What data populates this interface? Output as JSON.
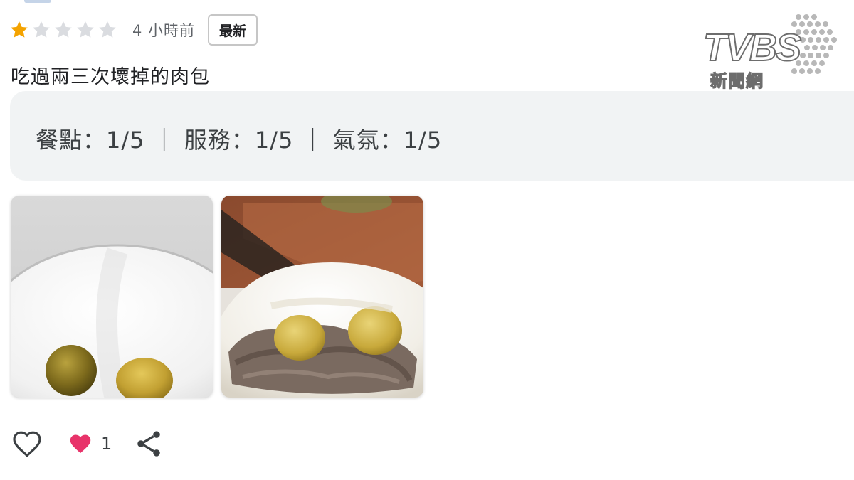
{
  "review": {
    "rating": 1,
    "rating_max": 5,
    "time_ago": "4 小時前",
    "badge": "最新",
    "text": "吃過兩三次壞掉的肉包",
    "subratings_text": "餐點：1/5 ｜ 服務：1/5 ｜ 氣氛：1/5"
  },
  "photos": [
    {
      "name": "photo-plate-with-chestnuts"
    },
    {
      "name": "photo-bun-with-filling"
    }
  ],
  "actions": {
    "like_icon": "heart-outline-icon",
    "reaction_icon": "heart-filled-icon",
    "like_count": "1",
    "share_icon": "share-icon"
  },
  "logo": {
    "wordmark": "TVBS",
    "sub": "新聞網"
  },
  "colors": {
    "star_filled": "#f4a300",
    "star_empty": "#dadce0",
    "heart_filled": "#e8336a",
    "panel_bg": "#f1f3f4"
  }
}
